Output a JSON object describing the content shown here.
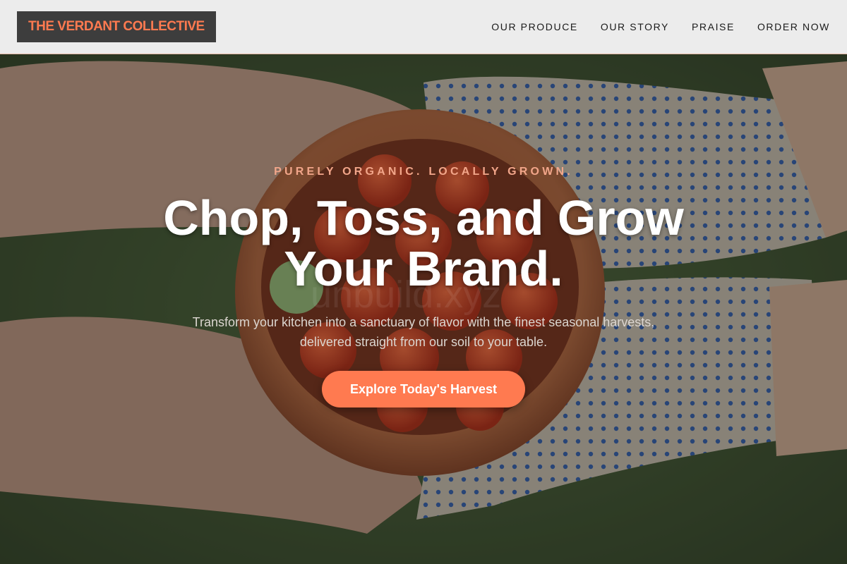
{
  "brand": {
    "name": "THE VERDANT COLLECTIVE"
  },
  "nav": {
    "items": [
      {
        "label": "OUR PRODUCE"
      },
      {
        "label": "OUR STORY"
      },
      {
        "label": "PRAISE"
      },
      {
        "label": "ORDER NOW"
      }
    ]
  },
  "hero": {
    "eyebrow": "PURELY ORGANIC. LOCALLY GROWN.",
    "headline_line1": "Chop, Toss, and Grow",
    "headline_line2": "Your Brand.",
    "subtext": "Transform your kitchen into a sanctuary of flavor with the finest seasonal harvests, delivered straight from our soil to your table.",
    "cta_label": "Explore Today's Harvest",
    "watermark": "unbuild.xyz"
  },
  "colors": {
    "accent": "#ff7a50",
    "nav_bg": "#ececec",
    "logo_bg": "#3d3d3d"
  }
}
